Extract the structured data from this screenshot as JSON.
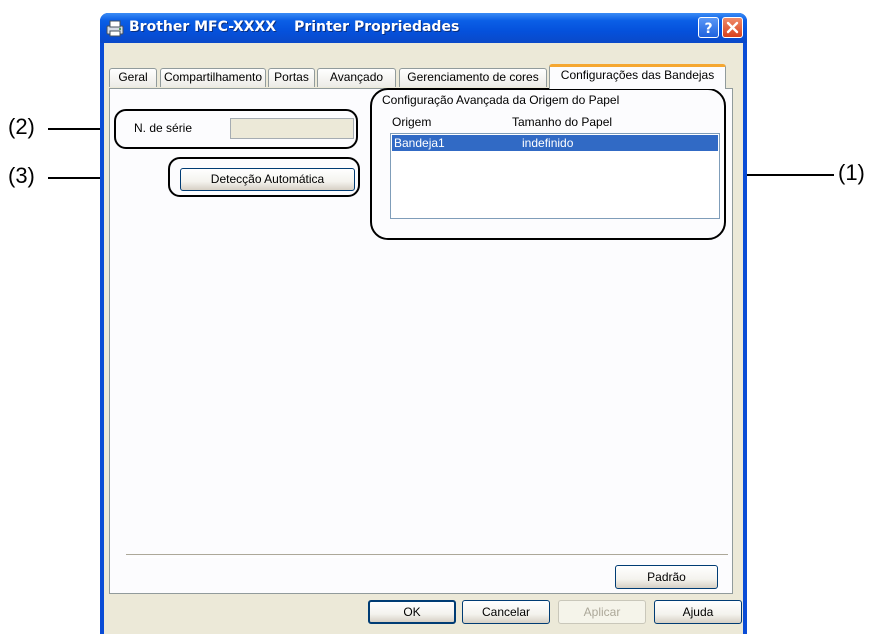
{
  "window": {
    "title_app": "Brother MFC-XXXX",
    "title_dialog": "Printer Propriedades",
    "help_button": "?",
    "close_button": "X",
    "icon": "printer-icon"
  },
  "tabs": [
    {
      "label": "Geral",
      "active": false
    },
    {
      "label": "Compartilhamento",
      "active": false
    },
    {
      "label": "Portas",
      "active": false
    },
    {
      "label": "Avançado",
      "active": false
    },
    {
      "label": "Gerenciamento de cores",
      "active": false
    },
    {
      "label": "Configurações das Bandejas",
      "active": true
    }
  ],
  "serial": {
    "label": "N. de série",
    "value": ""
  },
  "auto_detect_button": "Detecção Automática",
  "paper_source": {
    "group_title": "Configuração Avançada da Origem do Papel",
    "columns": [
      "Origem",
      "Tamanho do Papel"
    ],
    "rows": [
      {
        "origem": "Bandeja1",
        "tamanho": "indefinido",
        "selected": true
      }
    ]
  },
  "default_button": "Padrão",
  "footer_buttons": {
    "ok": "OK",
    "cancel": "Cancelar",
    "apply": "Aplicar",
    "help": "Ajuda"
  },
  "callouts": {
    "one": "(1)",
    "two": "(2)",
    "three": "(3)"
  },
  "colors": {
    "titlebar": "#0551dc",
    "selection": "#316ac5",
    "active_tab_accent": "#f5a731",
    "dialog_face": "#ece9d8"
  }
}
